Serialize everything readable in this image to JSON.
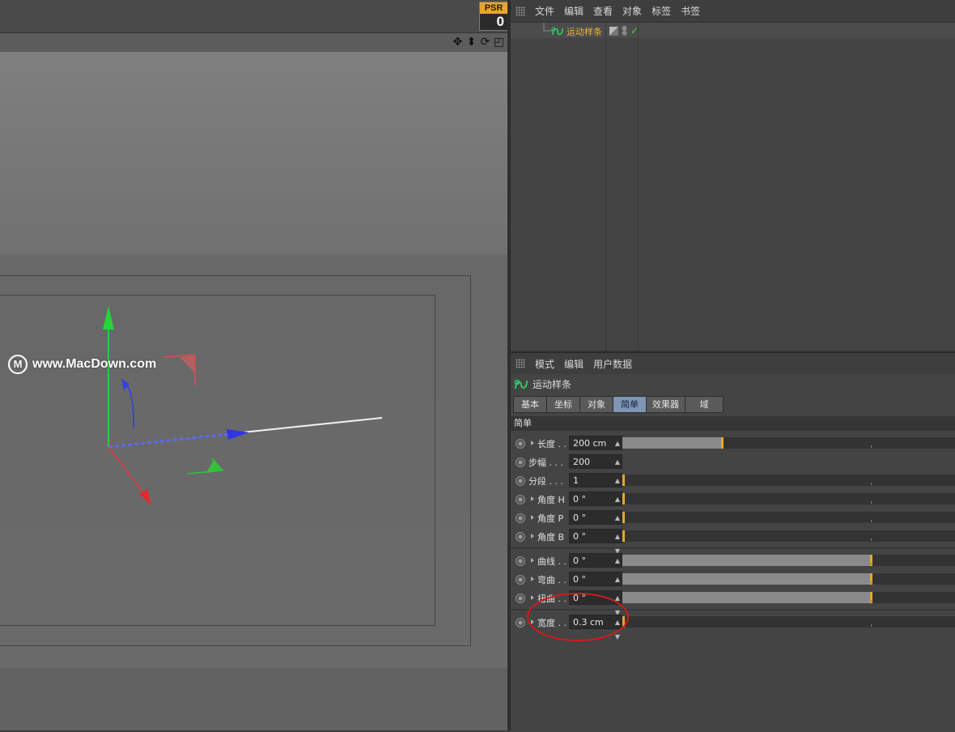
{
  "psr": {
    "label": "PSR",
    "value": "0"
  },
  "watermark": {
    "logo": "M",
    "text": "www.MacDown.com"
  },
  "viewport_tools": [
    "move-icon",
    "move-down-icon",
    "rotate-icon",
    "maximize-icon"
  ],
  "object_manager": {
    "menu": [
      "文件",
      "编辑",
      "查看",
      "对象",
      "标签",
      "书签"
    ],
    "objects": [
      {
        "name": "运动样条",
        "icon": "spline-icon",
        "visible": true,
        "enabled": true
      }
    ]
  },
  "attribute_manager": {
    "menu": [
      "模式",
      "编辑",
      "用户数据"
    ],
    "object_title": "运动样条",
    "tabs": [
      {
        "label": "基本",
        "active": false
      },
      {
        "label": "坐标",
        "active": false
      },
      {
        "label": "对象",
        "active": false
      },
      {
        "label": "简单",
        "active": true
      },
      {
        "label": "效果器",
        "active": false
      },
      {
        "label": "域",
        "active": false
      }
    ],
    "section": "简单",
    "params": [
      {
        "label": "长度 . .",
        "value": "200 cm",
        "slider": 0.3,
        "expand": true
      },
      {
        "label": "步幅 . . .",
        "value": "200",
        "slider": null,
        "expand": false
      },
      {
        "label": "分段 . . .",
        "value": "1",
        "slider": 0.0,
        "expand": false
      },
      {
        "label": "角度 H",
        "value": "0 °",
        "slider": 0.0,
        "expand": true
      },
      {
        "label": "角度 P",
        "value": "0 °",
        "slider": 0.0,
        "expand": true
      },
      {
        "label": "角度 B",
        "value": "0 °",
        "slider": 0.0,
        "expand": true
      },
      {
        "label": "曲线 . .",
        "value": "0 °",
        "slider": 0.75,
        "expand": true
      },
      {
        "label": "弯曲 . .",
        "value": "0 °",
        "slider": 0.75,
        "expand": true
      },
      {
        "label": "扭曲 . .",
        "value": "0 °",
        "slider": 0.75,
        "expand": true
      },
      {
        "label": "宽度 . .",
        "value": "0.3 cm",
        "slider": 0.0,
        "expand": true
      }
    ]
  },
  "colors": {
    "accent": "#e9a52a",
    "selected_object": "#e9b53a",
    "active_tab": "#7f96b5",
    "annotation": "#d21a1a"
  }
}
